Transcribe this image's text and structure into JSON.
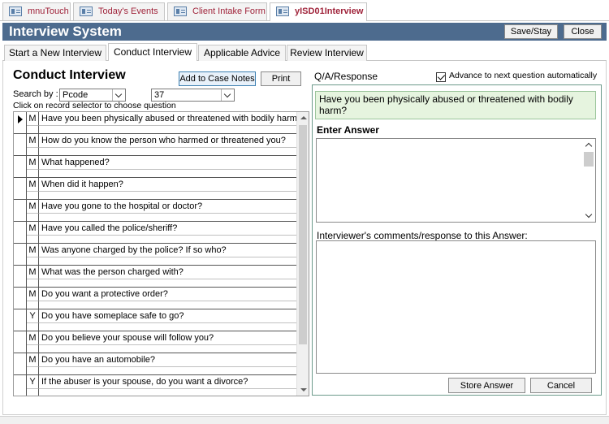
{
  "document_tabs": [
    {
      "label": "mnuTouch",
      "active": false
    },
    {
      "label": "Today's Events",
      "active": false
    },
    {
      "label": "Client Intake Form",
      "active": false
    },
    {
      "label": "yISD01Interview",
      "active": true
    }
  ],
  "header": {
    "title": "Interview System",
    "save_stay_label": "Save/Stay",
    "close_label": "Close"
  },
  "form_tabs": [
    {
      "label": "Start a New Interview",
      "active": false
    },
    {
      "label": "Conduct Interview",
      "active": true
    },
    {
      "label": "Applicable Advice",
      "active": false
    },
    {
      "label": "Review Interview",
      "active": false
    }
  ],
  "conduct": {
    "title": "Conduct Interview",
    "add_case_notes_label": "Add to Case Notes",
    "print_label": "Print",
    "search_by_label": "Search by :",
    "search_field_value": "Pcode",
    "search_value": "37",
    "instruction": "Click on record selector to choose question"
  },
  "questions": [
    {
      "flag": "M",
      "text": "Have you been physically abused or threatened with bodily harm?",
      "current": true
    },
    {
      "flag": "M",
      "text": "How do you know the person who harmed or threatened you?",
      "current": false
    },
    {
      "flag": "M",
      "text": "What happened?",
      "current": false
    },
    {
      "flag": "M",
      "text": "When did it happen?",
      "current": false
    },
    {
      "flag": "M",
      "text": "Have you gone to the hospital or doctor?",
      "current": false
    },
    {
      "flag": "M",
      "text": "Have you called the police/sheriff?",
      "current": false
    },
    {
      "flag": "M",
      "text": "Was anyone charged by the police? If so who?",
      "current": false
    },
    {
      "flag": "M",
      "text": "What was the person charged with?",
      "current": false
    },
    {
      "flag": "M",
      "text": "Do you want a protective order?",
      "current": false
    },
    {
      "flag": "Y",
      "text": "Do you have someplace safe to go?",
      "current": false
    },
    {
      "flag": "M",
      "text": "Do you believe your spouse will follow you?",
      "current": false
    },
    {
      "flag": "M",
      "text": "Do you have an automobile?",
      "current": false
    },
    {
      "flag": "Y",
      "text": "If the abuser is your spouse, do you want a divorce?",
      "current": false
    }
  ],
  "qa": {
    "label": "Q/A/Response",
    "advance_label": "Advance to next question automatically",
    "advance_checked": true,
    "current_question": "Have you been physically abused or threatened with bodily harm?",
    "enter_answer_label": "Enter Answer",
    "answer_value": "",
    "comments_label": "Interviewer's comments/response to this Answer:",
    "comments_value": "",
    "store_answer_label": "Store Answer",
    "cancel_label": "Cancel"
  },
  "colors": {
    "header_bg": "#4d6b8e",
    "tab_text": "#a0243b",
    "question_bg": "#e6f4df",
    "panel_border": "#6c9a8b"
  }
}
